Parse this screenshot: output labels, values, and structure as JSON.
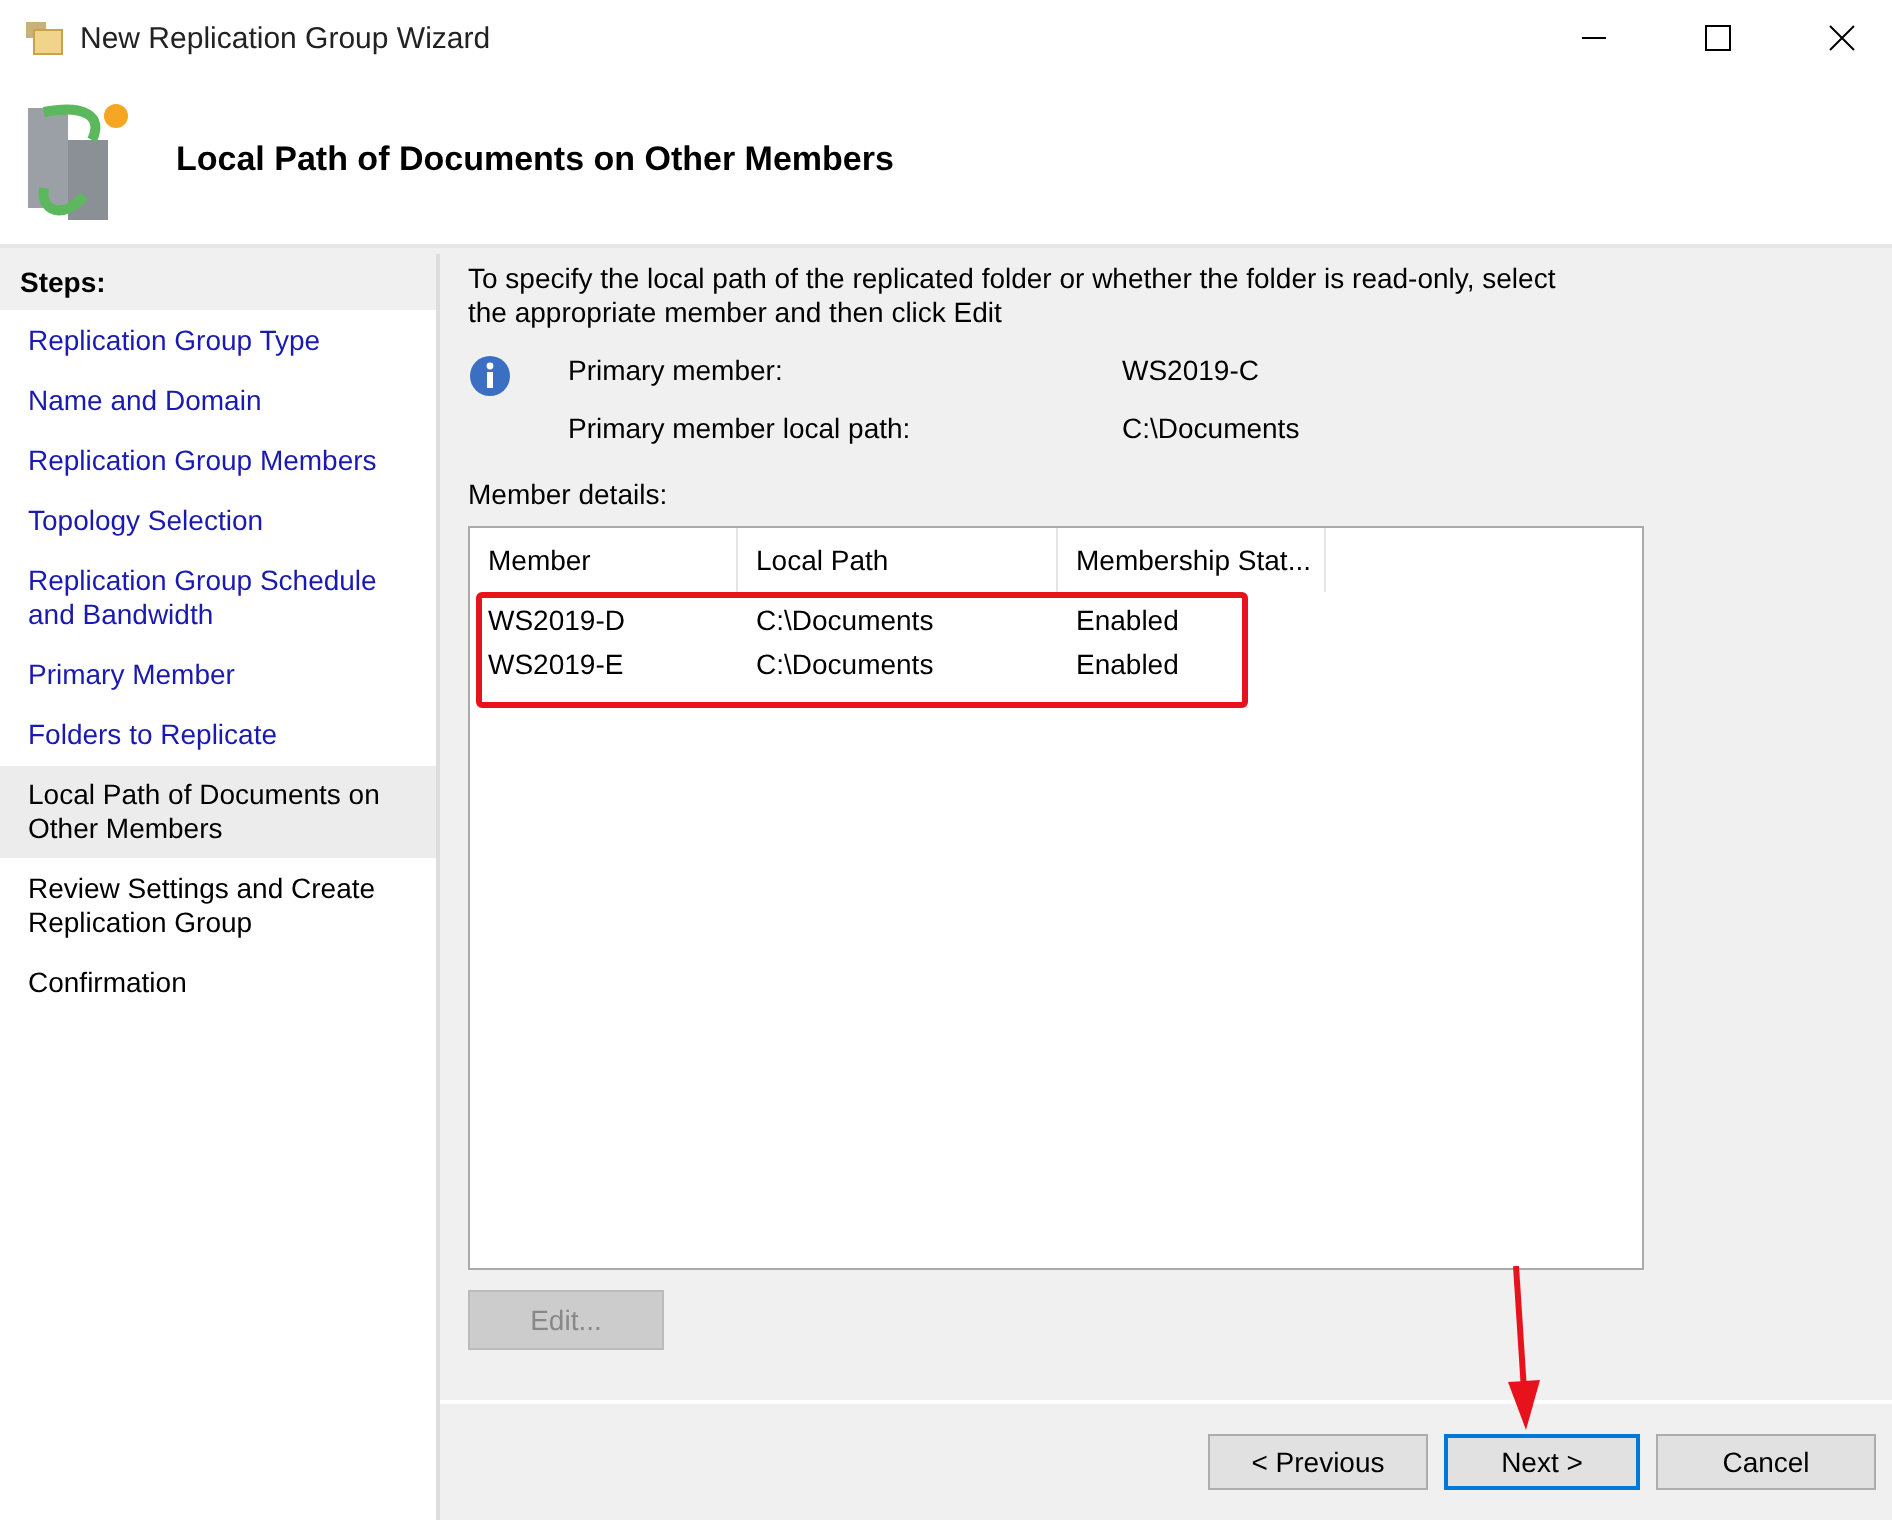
{
  "window": {
    "title": "New Replication Group Wizard"
  },
  "header": {
    "title": "Local Path of Documents on Other Members"
  },
  "steps": {
    "heading": "Steps:",
    "items": [
      {
        "label": "Replication Group Type",
        "done": true,
        "selected": false
      },
      {
        "label": "Name and Domain",
        "done": true,
        "selected": false
      },
      {
        "label": "Replication Group Members",
        "done": true,
        "selected": false
      },
      {
        "label": "Topology Selection",
        "done": true,
        "selected": false
      },
      {
        "label": "Replication Group Schedule and Bandwidth",
        "done": true,
        "selected": false
      },
      {
        "label": "Primary Member",
        "done": true,
        "selected": false
      },
      {
        "label": "Folders to Replicate",
        "done": true,
        "selected": false
      },
      {
        "label": "Local Path of Documents on Other Members",
        "done": false,
        "selected": true
      },
      {
        "label": "Review Settings and Create Replication Group",
        "done": false,
        "selected": false
      },
      {
        "label": "Confirmation",
        "done": false,
        "selected": false
      }
    ]
  },
  "instructions": "To specify the local path of the replicated folder or whether the folder is read-only, select the appropriate member and then click Edit",
  "info": [
    {
      "label": "Primary member:",
      "value": "WS2019-C"
    },
    {
      "label": "Primary member local path:",
      "value": "C:\\Documents"
    }
  ],
  "member_details": {
    "label": "Member details:",
    "highlighted": true,
    "columns": [
      "Member",
      "Local Path",
      "Membership Stat..."
    ],
    "rows": [
      [
        "WS2019-D",
        "C:\\Documents",
        "Enabled"
      ],
      [
        "WS2019-E",
        "C:\\Documents",
        "Enabled"
      ]
    ]
  },
  "edit_button": {
    "label": "Edit...",
    "disabled": true
  },
  "buttons": [
    {
      "label": "< Previous",
      "focused": false,
      "pointed_at": false
    },
    {
      "label": "Next >",
      "focused": true,
      "pointed_at": true
    },
    {
      "label": "Cancel",
      "focused": false,
      "pointed_at": false
    }
  ]
}
